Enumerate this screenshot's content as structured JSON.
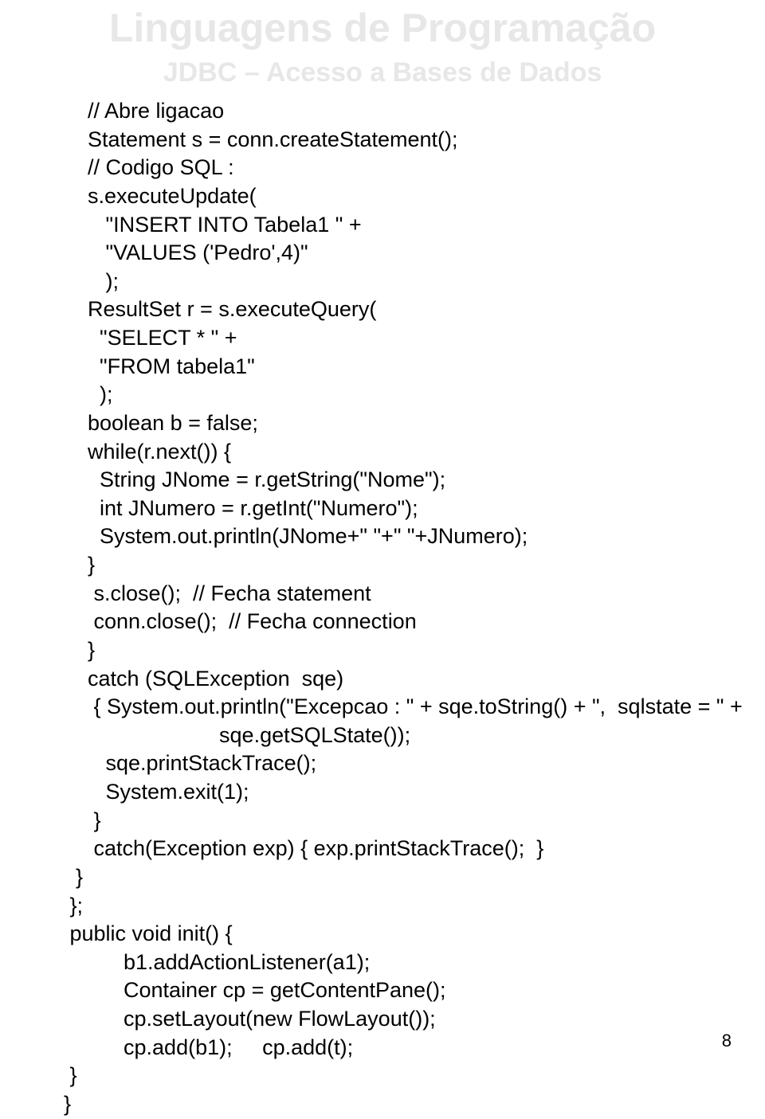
{
  "header": {
    "title1": "Linguagens de Programação",
    "title2": "JDBC – Acesso a Bases de Dados"
  },
  "code": {
    "lines": [
      "    // Abre ligacao",
      "    Statement s = conn.createStatement();",
      "    // Codigo SQL :",
      "    s.executeUpdate(",
      "       \"INSERT INTO Tabela1 \" +",
      "       \"VALUES ('Pedro',4)\"",
      "       );",
      "    ResultSet r = s.executeQuery(",
      "      \"SELECT * \" +",
      "      \"FROM tabela1\"",
      "      );",
      "    boolean b = false;",
      "    while(r.next()) {",
      "      String JNome = r.getString(\"Nome\");",
      "      int JNumero = r.getInt(\"Numero\");",
      "      System.out.println(JNome+\" \"+\" \"+JNumero);",
      "    }",
      "     s.close();  // Fecha statement",
      "     conn.close();  // Fecha connection",
      "    }",
      "    catch (SQLException  sqe)",
      "     { System.out.println(\"Excepcao : \" + sqe.toString() + \",  sqlstate = \" +",
      "                          sqe.getSQLState());",
      "       sqe.printStackTrace();",
      "       System.exit(1);",
      "     }",
      "     catch(Exception exp) { exp.printStackTrace();  }",
      "  }",
      " };",
      " public void init() {",
      "          b1.addActionListener(a1);",
      "          Container cp = getContentPane();",
      "          cp.setLayout(new FlowLayout());",
      "          cp.add(b1);     cp.add(t);",
      " }",
      "}"
    ]
  },
  "page_number": "8"
}
